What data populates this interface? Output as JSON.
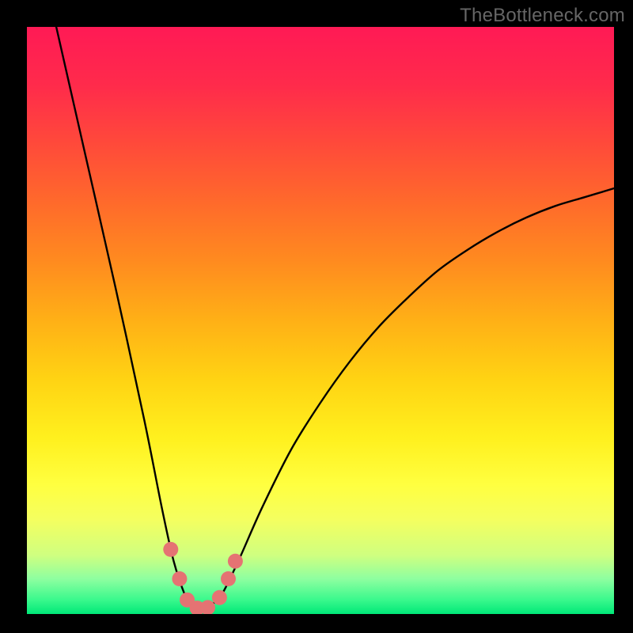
{
  "watermark": "TheBottleneck.com",
  "gradient": {
    "stops": [
      {
        "offset": 0.0,
        "color": "#ff1a55"
      },
      {
        "offset": 0.1,
        "color": "#ff2b4b"
      },
      {
        "offset": 0.2,
        "color": "#ff4a3a"
      },
      {
        "offset": 0.3,
        "color": "#ff6a2b"
      },
      {
        "offset": 0.4,
        "color": "#ff8b1f"
      },
      {
        "offset": 0.5,
        "color": "#ffb016"
      },
      {
        "offset": 0.6,
        "color": "#ffd313"
      },
      {
        "offset": 0.7,
        "color": "#fff01e"
      },
      {
        "offset": 0.78,
        "color": "#ffff40"
      },
      {
        "offset": 0.84,
        "color": "#f4ff60"
      },
      {
        "offset": 0.9,
        "color": "#cfff80"
      },
      {
        "offset": 0.94,
        "color": "#8effa0"
      },
      {
        "offset": 0.975,
        "color": "#3cf98d"
      },
      {
        "offset": 1.0,
        "color": "#00e878"
      }
    ]
  },
  "chart_data": {
    "type": "line",
    "title": "",
    "xlabel": "",
    "ylabel": "",
    "xlim": [
      0,
      100
    ],
    "ylim": [
      0,
      100
    ],
    "series": [
      {
        "name": "bottleneck-curve",
        "x": [
          5,
          10,
          15,
          20,
          23,
          25,
          27,
          28,
          29,
          30,
          31,
          33,
          36,
          40,
          45,
          50,
          55,
          60,
          65,
          70,
          75,
          80,
          85,
          90,
          95,
          100
        ],
        "values": [
          100,
          78,
          56,
          33,
          18,
          9,
          3,
          1.5,
          1,
          1,
          1.5,
          3,
          9,
          18,
          28,
          36,
          43,
          49,
          54,
          58.5,
          62,
          65,
          67.5,
          69.5,
          71,
          72.5
        ]
      }
    ],
    "markers": {
      "name": "highlight-dots",
      "color": "#e57373",
      "points": [
        {
          "x": 24.5,
          "y": 11
        },
        {
          "x": 26.0,
          "y": 6
        },
        {
          "x": 27.3,
          "y": 2.4
        },
        {
          "x": 29.0,
          "y": 1.0
        },
        {
          "x": 30.8,
          "y": 1.1
        },
        {
          "x": 32.8,
          "y": 2.8
        },
        {
          "x": 34.3,
          "y": 6.0
        },
        {
          "x": 35.5,
          "y": 9.0
        }
      ]
    }
  }
}
